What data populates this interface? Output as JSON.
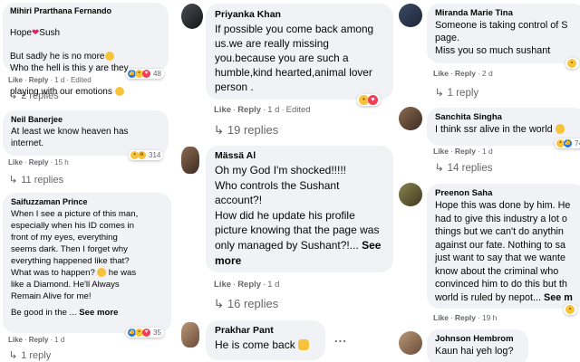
{
  "col1": {
    "c1": {
      "author": "Mihiri Prarthana Fernando",
      "line1_a": "Hope",
      "line1_b": "Sush",
      "line2": "But sadly he is no more",
      "line3": "Who the hell is this y are they",
      "line4": "playing with our emotions",
      "reaction_count": "48",
      "like": "Like",
      "reply": "Reply",
      "time": "1 d",
      "edited": "Edited",
      "replies": "2 replies"
    },
    "c2": {
      "author": "Neil Banerjee",
      "line1": "At least we know heaven has",
      "line2": "internet.",
      "reaction_count": "314",
      "like": "Like",
      "reply": "Reply",
      "time": "15 h",
      "replies": "11 replies"
    },
    "c3": {
      "author": "Saifuzzaman Prince",
      "text": "When I see a picture of this man,\nespecially when his ID comes in\nfront of my eyes, everything\nseems dark. Then I forget why\neverything happened like that?\nWhat was to happen?",
      "text_tail": "he was",
      "text2": "like a Diamond. He'll Always\nRemain Alive for me!",
      "text3": "Be good in the ...",
      "see_more": "See more",
      "reaction_count": "35",
      "like": "Like",
      "reply": "Reply",
      "time": "1 d",
      "replies": "1 reply"
    }
  },
  "col2": {
    "c1": {
      "author": "Priyanka Khan",
      "text": "If possible you come back among\nus.we are really missing\nyou.because you are such a\nhumble,kind hearted,animal lover\nperson .",
      "like": "Like",
      "reply": "Reply",
      "time": "1 d",
      "edited": "Edited",
      "replies": "19 replies"
    },
    "c2": {
      "author": "Mässä Al",
      "text": "Oh my God I'm shocked!!!!!\nWho controls the Sushant\naccount?!\nHow did he update his profile\npicture knowing that the page was\nonly managed by Sushant?!...",
      "see_more_a": "See",
      "see_more_b": "more",
      "like": "Like",
      "reply": "Reply",
      "time": "1 d",
      "replies": "16 replies"
    },
    "c3": {
      "author": "Prakhar Pant",
      "text": "He is come back",
      "more": "..."
    }
  },
  "col3": {
    "c1": {
      "author": "Miranda Marie Tina",
      "text": "Someone is taking control of S\npage.\nMiss you so much sushant",
      "like": "Like",
      "reply": "Reply",
      "time": "2 d",
      "replies": "1 reply"
    },
    "c2": {
      "author": "Sanchita Singha",
      "text": "I think ssr alive in the world",
      "reaction_count": "74",
      "like": "Like",
      "reply": "Reply",
      "time": "1 d",
      "replies": "14 replies"
    },
    "c3": {
      "author": "Preenon Saha",
      "text": "Hope this was done by him. He\nhad to give this industry a lot o\nthings but we can't do anythin\nagainst our fate. Nothing to sa\njust want to say that we wante\nknow about the criminal who\nconvinced him to do this but th\nworld is ruled by nepot...",
      "see_more": "See m",
      "like": "Like",
      "reply": "Reply",
      "time": "19 h"
    },
    "c4": {
      "author": "Johnson Hembrom",
      "text": "Kaun hai yeh log?"
    }
  },
  "colors": {
    "bubble": "#f0f2f5",
    "text": "#050505",
    "meta": "#65676b",
    "like_blue": "#1877f2",
    "love_red": "#f33e58",
    "haha_yellow": "#f7c33b"
  }
}
